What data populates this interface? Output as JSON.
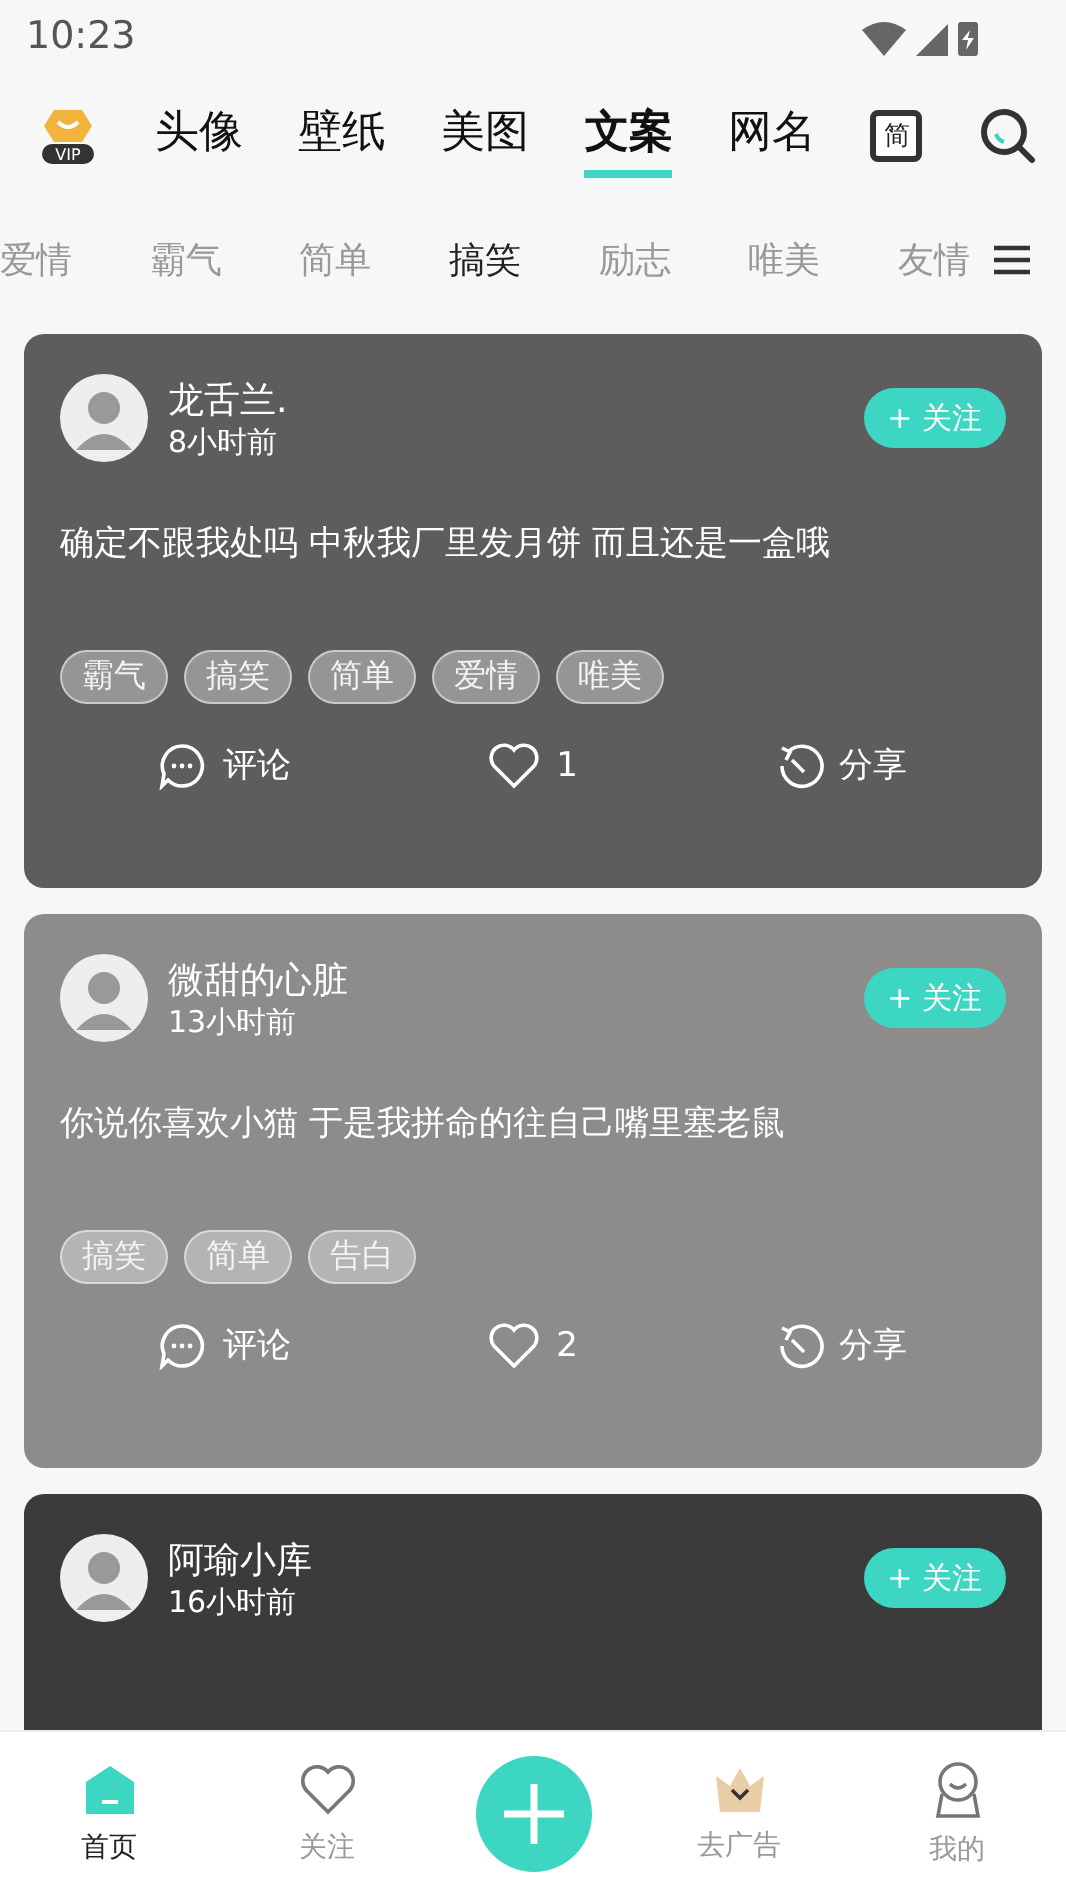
{
  "status_bar": {
    "time": "10:23"
  },
  "top_tabs": [
    {
      "label": "头像",
      "selected": false
    },
    {
      "label": "壁纸",
      "selected": false
    },
    {
      "label": "美图",
      "selected": false
    },
    {
      "label": "文案",
      "selected": true
    },
    {
      "label": "网名",
      "selected": false
    }
  ],
  "top_actions": {
    "vip_badge": "VIP",
    "simplified_label": "简"
  },
  "categories": [
    {
      "label": "爱情",
      "selected": false
    },
    {
      "label": "霸气",
      "selected": false
    },
    {
      "label": "简单",
      "selected": false
    },
    {
      "label": "搞笑",
      "selected": true
    },
    {
      "label": "励志",
      "selected": false
    },
    {
      "label": "唯美",
      "selected": false
    },
    {
      "label": "友情",
      "selected": false
    }
  ],
  "posts": [
    {
      "author": "龙舌兰.",
      "time": "8小时前",
      "follow": "+ 关注",
      "text": "确定不跟我处吗  中秋我厂里发月饼 而且还是一盒哦",
      "tags": [
        "霸气",
        "搞笑",
        "简单",
        "爱情",
        "唯美"
      ],
      "comment": "评论",
      "likes": "1",
      "share": "分享"
    },
    {
      "author": "微甜的心脏",
      "time": "13小时前",
      "follow": "+ 关注",
      "text": "你说你喜欢小猫 于是我拼命的往自己嘴里塞老鼠",
      "tags": [
        "搞笑",
        "简单",
        "告白"
      ],
      "comment": "评论",
      "likes": "2",
      "share": "分享"
    },
    {
      "author": "阿瑜小库",
      "time": "16小时前",
      "follow": "+ 关注"
    }
  ],
  "bottom_nav": [
    {
      "kind": "home",
      "label": "首页",
      "selected": true
    },
    {
      "kind": "follow",
      "label": "关注",
      "selected": false
    },
    {
      "kind": "add",
      "selected": false
    },
    {
      "kind": "noads",
      "label": "去广告",
      "selected": false
    },
    {
      "kind": "me",
      "label": "我的",
      "selected": false
    }
  ]
}
